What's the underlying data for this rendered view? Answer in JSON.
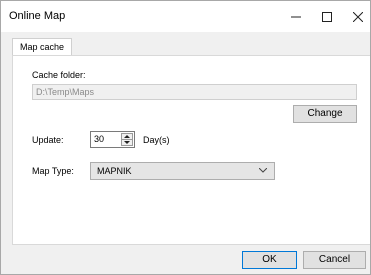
{
  "window": {
    "title": "Online Map",
    "controls": {
      "minimize": "minimize-icon",
      "maximize": "maximize-icon",
      "close": "close-icon"
    }
  },
  "tabs": [
    {
      "label": "Map cache",
      "selected": true
    }
  ],
  "cache": {
    "folder_label": "Cache folder:",
    "folder_value": "D:\\Temp\\Maps",
    "change_button": "Change"
  },
  "update": {
    "label": "Update:",
    "value": "30",
    "unit": "Day(s)"
  },
  "map_type": {
    "label": "Map Type:",
    "selected": "MAPNIK"
  },
  "footer": {
    "ok": "OK",
    "cancel": "Cancel"
  },
  "colors": {
    "accent": "#0078d7",
    "window_bg": "#f0f0f0",
    "panel_bg": "#ffffff"
  }
}
